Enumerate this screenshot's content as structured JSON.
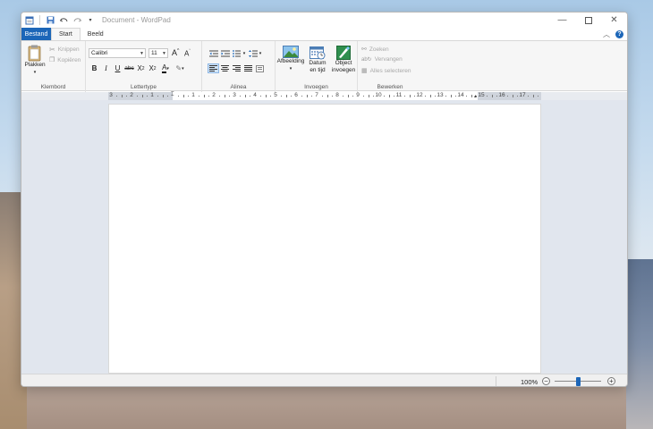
{
  "window": {
    "title": "Document - WordPad"
  },
  "tabs": {
    "file": "Bestand",
    "home": "Start",
    "view": "Beeld"
  },
  "ribbon": {
    "clipboard": {
      "label": "Klembord",
      "paste": "Plakken",
      "cut": "Knippen",
      "copy": "Kopiëren"
    },
    "font": {
      "label": "Lettertype",
      "family": "Calibri",
      "size": "11"
    },
    "paragraph": {
      "label": "Alinea"
    },
    "insert": {
      "label": "Invoegen",
      "picture": "Afbeelding",
      "datetime_l1": "Datum",
      "datetime_l2": "en tijd",
      "object_l1": "Object",
      "object_l2": "invoegen"
    },
    "editing": {
      "label": "Bewerken",
      "find": "Zoeken",
      "replace": "Vervangen",
      "select_all": "Alles selecteren"
    }
  },
  "ruler": {
    "labels": [
      "3",
      "2",
      "1",
      "1",
      "2",
      "3",
      "4",
      "5",
      "6",
      "7",
      "8",
      "9",
      "10",
      "11",
      "12",
      "13",
      "14",
      "15",
      "16",
      "17"
    ]
  },
  "status": {
    "zoom": "100%"
  },
  "colors": {
    "accent": "#1c66b8"
  }
}
